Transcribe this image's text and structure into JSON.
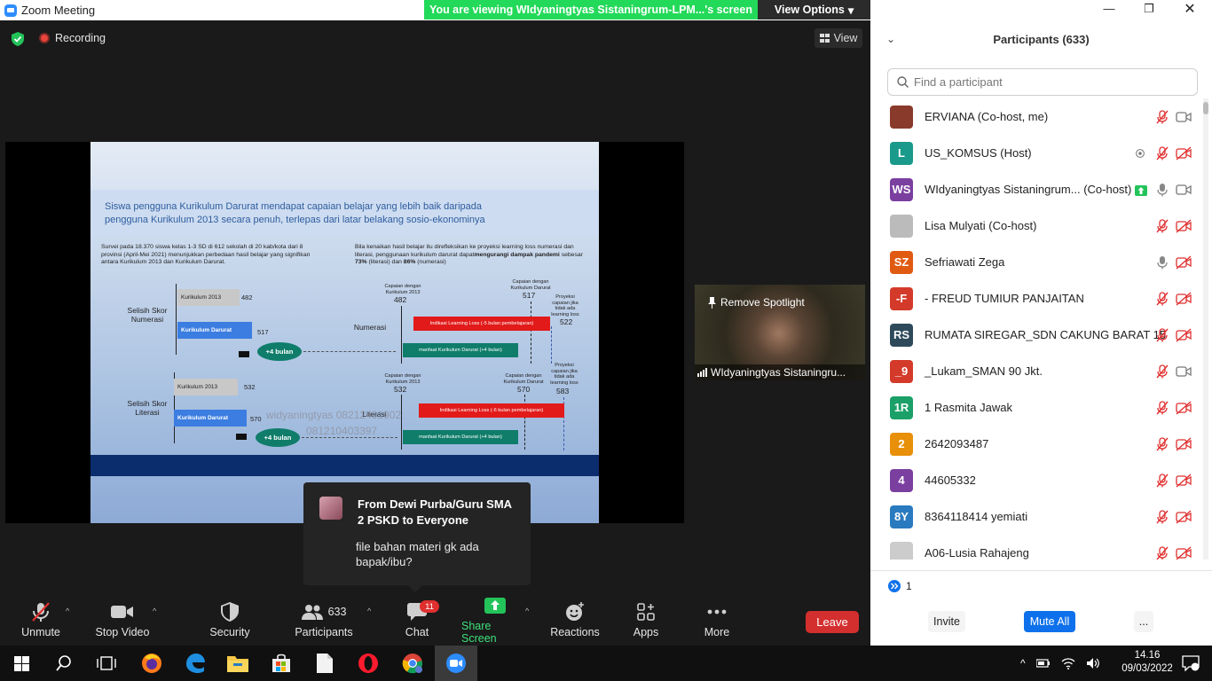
{
  "window": {
    "title": "Zoom Meeting",
    "banner": "You are viewing WIdyaningtyas Sistaningrum-LPM...'s screen",
    "view_options": "View Options"
  },
  "meeting": {
    "recording": "Recording",
    "view_label": "View"
  },
  "slide": {
    "heading": "Siswa pengguna Kurikulum Darurat mendapat capaian belajar yang lebih baik  daripada pengguna Kurikulum 2013 secara penuh, terlepas dari latar belakang  sosio-ekonominya",
    "note_left": "Survei pada 18.370 siswa kelas 1-3 SD di 612 sekolah di 20 kab/kota dari 8 provinsi (April-Mei 2021) menunjukkan perbedaan hasil belajar yang signifikan antara Kurikulum 2013 dan Kurikulum Darurat.",
    "note_right_a": "Bila kenaikan hasil belajar itu direfleksikan ke proyeksi learning loss numerasi dan literasi, penggunaan kurikulum darurat dapat",
    "note_right_b": "mengurangi dampak pandemi",
    "note_right_c": " sebesar ",
    "note_right_d": "73%",
    "note_right_e": " (literasi) dan ",
    "note_right_f": "86%",
    "note_right_g": " (numerasi)",
    "numerasi": {
      "row_label": "Selisih Skor Numerasi",
      "k13_label": "Kurikulum 2013",
      "k13_value": "482",
      "kd_label": "Kurikulum Darurat",
      "kd_value": "517",
      "gain": "+4 bulan",
      "right_label": "Numerasi",
      "cap13_label": "Capaian dengan Kurikulum 2013",
      "cap13_value": "482",
      "capkd_label": "Capaian dengan Kurikulum Darurat",
      "capkd_value": "517",
      "proj_label": "Proyeksi capaian jika tidak ada learning loss",
      "proj_value": "522",
      "loss_arrow": "Indikasi Learning Loss (-5 bulan pembelajaran)",
      "benefit_arrow": "manfaat Kurikulum Darurat (+4 bulan)"
    },
    "literasi": {
      "row_label": "Selisih Skor Literasi",
      "k13_label": "Kurikulum 2013",
      "k13_value": "532",
      "kd_label": "Kurikulum Darurat",
      "kd_value": "570",
      "gain": "+4 bulan",
      "right_label": "Literasi",
      "cap13_label": "Capaian dengan Kurikulum 2013",
      "cap13_value": "532",
      "capkd_label": "Capaian dengan Kurikulum Darurat",
      "capkd_value": "570",
      "proj_label": "Proyeksi capaian jika tidak ada learning loss",
      "proj_value": "583",
      "loss_arrow": "Indikasi Learning Loss (-6 bulan pembelajaran)",
      "benefit_arrow": "manfaat Kurikulum Darurat (+4 bulan)"
    },
    "watermark_1": "widyaningtyas 08212401902",
    "watermark_2": "081210403397"
  },
  "video_tile": {
    "spotlight": "Remove Spotlight",
    "name": "WIdyaningtyas Sistaningru..."
  },
  "chat_popup": {
    "from": "From Dewi Purba/Guru SMA 2 PSKD to Everyone",
    "message": "file bahan materi gk ada bapak/ibu?"
  },
  "toolbar": {
    "unmute": "Unmute",
    "stop_video": "Stop Video",
    "security": "Security",
    "participants": "Participants",
    "participants_count": "633",
    "chat": "Chat",
    "chat_badge": "11",
    "share_screen": "Share Screen",
    "reactions": "Reactions",
    "apps": "Apps",
    "more": "More",
    "leave": "Leave"
  },
  "panel": {
    "title": "Participants (633)",
    "search_placeholder": "Find a participant",
    "participants": [
      {
        "name": "ERVIANA (Co-host, me)",
        "initials": "",
        "color": "#8a3a2a",
        "mic": "muted",
        "video": "on"
      },
      {
        "name": "US_KOMSUS (Host)",
        "initials": "L",
        "color": "#1a9a8a",
        "mic": "muted",
        "video": "off"
      },
      {
        "name": "WIdyaningtyas Sistaningrum...  (Co-host)",
        "initials": "WS",
        "color": "#7b3fa0",
        "mic": "on",
        "video": "on"
      },
      {
        "name": "Lisa Mulyati (Co-host)",
        "initials": "",
        "color": "#bbbbbb",
        "mic": "muted",
        "video": "off"
      },
      {
        "name": "Sefriawati Zega",
        "initials": "SZ",
        "color": "#e05a12",
        "mic": "on",
        "video": "off"
      },
      {
        "name": "- FREUD TUMIUR PANJAITAN",
        "initials": "-F",
        "color": "#d43a2a",
        "mic": "muted",
        "video": "off"
      },
      {
        "name": " RUMATA SIREGAR_SDN CAKUNG BARAT 15",
        "initials": "RS",
        "color": "#2e4a5a",
        "mic": "muted",
        "video": "off"
      },
      {
        "name": "_Lukam_SMAN 90 Jkt.",
        "initials": "_9",
        "color": "#d43a2a",
        "mic": "muted",
        "video": "on"
      },
      {
        "name": "1 Rasmita Jawak",
        "initials": "1R",
        "color": "#1aa068",
        "mic": "muted",
        "video": "off"
      },
      {
        "name": "2642093487",
        "initials": "2",
        "color": "#e8900a",
        "mic": "muted",
        "video": "off"
      },
      {
        "name": "44605332",
        "initials": "4",
        "color": "#7b3fa0",
        "mic": "muted",
        "video": "off"
      },
      {
        "name": "8364118414 yemiati",
        "initials": "8Y",
        "color": "#2a7ac0",
        "mic": "muted",
        "video": "off"
      },
      {
        "name": "A06-Lusia Rahajeng",
        "initials": "",
        "color": "#cccccc",
        "mic": "muted",
        "video": "off"
      }
    ],
    "more_pages": "1",
    "invite": "Invite",
    "mute_all": "Mute All",
    "more": "..."
  },
  "taskbar": {
    "time": "14.16",
    "date": "09/03/2022"
  },
  "colors": {
    "banner_green": "#23d959",
    "leave_red": "#d32f2f",
    "mute_all_blue": "#0e71eb",
    "muted_icon_red": "#e02f2f"
  }
}
